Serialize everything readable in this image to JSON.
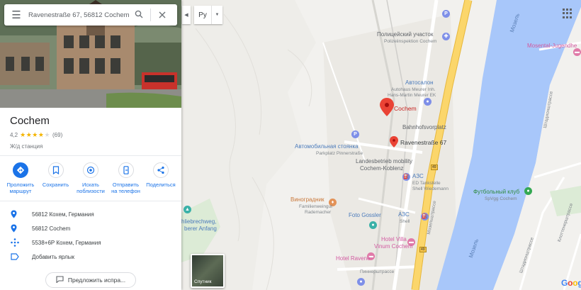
{
  "search": {
    "value": "Ravenestraße 67, 56812 Cochem"
  },
  "place": {
    "title": "Cochem",
    "rating": "4,2",
    "stars": 4.2,
    "reviews": "(69)",
    "category": "Ж/д станция"
  },
  "actions": [
    {
      "label": "Проложить маршрут",
      "icon": "directions-icon"
    },
    {
      "label": "Сохранить",
      "icon": "bookmark-icon"
    },
    {
      "label": "Искать поблизости",
      "icon": "nearby-icon"
    },
    {
      "label": "Отправить на телефон",
      "icon": "send-to-phone-icon"
    },
    {
      "label": "Поделиться",
      "icon": "share-icon"
    }
  ],
  "details": [
    {
      "text": "56812 Кохем, Германия",
      "icon": "location-pin-icon"
    },
    {
      "text": "56812 Cochem",
      "icon": "location-pin-icon"
    },
    {
      "text": "5538+6P Кохем, Германия",
      "icon": "plus-code-icon"
    },
    {
      "text": "Добавить ярлык",
      "icon": "label-icon"
    }
  ],
  "suggest_edit": "Предложить испра...",
  "map": {
    "language": "Ру",
    "satellite_label": "Спутник",
    "labels": {
      "police": "Полицейский участок",
      "police_sub": "Polizeiinspektion Cochem",
      "autosalon": "Автосалон",
      "autosalon_sub1": "Autohaus Meurer Inh.",
      "autosalon_sub2": "Hans-Martin Meurer EK",
      "cochem_marker": "Cochem",
      "bahnhofsvorplatz": "Bahnhofsvorplatz",
      "ravene_marker": "Ravenestraße 67",
      "parking": "Автомобильная стоянка",
      "parking_sub": "Parkplatz Pinnerstraße",
      "landesbetrieb1": "Landesbetrieb mobility",
      "landesbetrieb2": "Cochem-Koblenz",
      "azs1": "АЗС",
      "azs1_sub1": "ED Tankstelle",
      "azs1_sub2": "Shell Wiedemann",
      "vineyard": "Виноградник",
      "vineyard_sub1": "Familienweingut",
      "vineyard_sub2": "Rademacher",
      "foto": "Foto Gossler",
      "azs2": "АЗС",
      "azs2_sub": "Shell",
      "hotel_villa1": "Hotel Villa",
      "hotel_villa2": "Vinum Cochem",
      "hotel_ravene": "Hotel Ravené",
      "pinner": "Пиннерштрассе",
      "moselle_top": "Мозель",
      "moselle_bottom": "Мозель",
      "mosel_river_road": "Мозельштрассе",
      "football1": "Футбольный клуб",
      "football2": "SpVgg Cochem",
      "jugend": "Mosental-Jugendhe",
      "schlieb1": "hliebrechweg,",
      "schlieb2": "berer Anfang",
      "shtadion": "Штадионштрассе",
      "klotten": "Клоттенерштрассе",
      "route49": "49"
    },
    "google": [
      "G",
      "o",
      "o",
      "g",
      "l",
      "e"
    ],
    "google_colors": [
      "#4285f4",
      "#ea4335",
      "#fbbc05",
      "#4285f4",
      "#34a853",
      "#ea4335"
    ],
    "river_color": "#a8c7fa",
    "road_color": "#fbd66b"
  }
}
